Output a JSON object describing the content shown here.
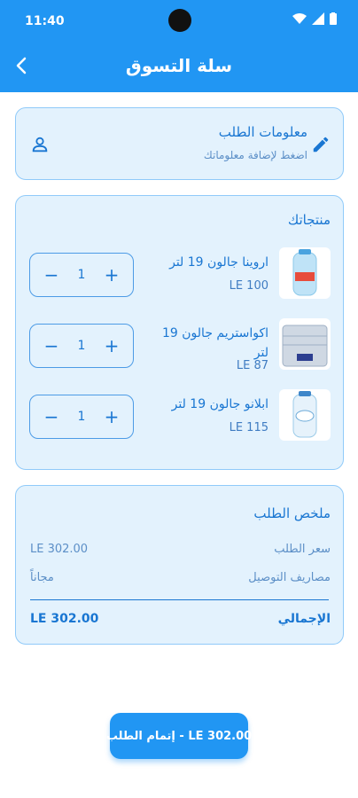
{
  "status_bar": {
    "time": "11:40"
  },
  "app_bar": {
    "title": "سلة التسوق"
  },
  "order_info": {
    "title": "معلومات الطلب",
    "subtitle": "اضغط لإضافة معلوماتك"
  },
  "products": {
    "heading": "منتجاتك",
    "items": [
      {
        "name": "اروينا جالون 19 لتر",
        "price": "LE 100",
        "quantity": "1"
      },
      {
        "name": "اكواستريم جالون 19 لتر",
        "price": "LE 87",
        "quantity": "1"
      },
      {
        "name": "ابلانو جالون 19 لتر",
        "price": "LE 115",
        "quantity": "1"
      }
    ]
  },
  "summary": {
    "heading": "ملخص الطلب",
    "order_price_label": "سعر الطلب",
    "order_price_value": "LE 302.00",
    "delivery_label": "مصاريف التوصيل",
    "delivery_value": "مجاناً",
    "total_label": "الإجمالي",
    "total_value": "LE 302.00"
  },
  "checkout": {
    "label": "LE 302.00 - إتمام الطلب"
  },
  "colors": {
    "primary": "#2196f3",
    "card_bg": "#e3f2fd",
    "text": "#1976d2"
  }
}
